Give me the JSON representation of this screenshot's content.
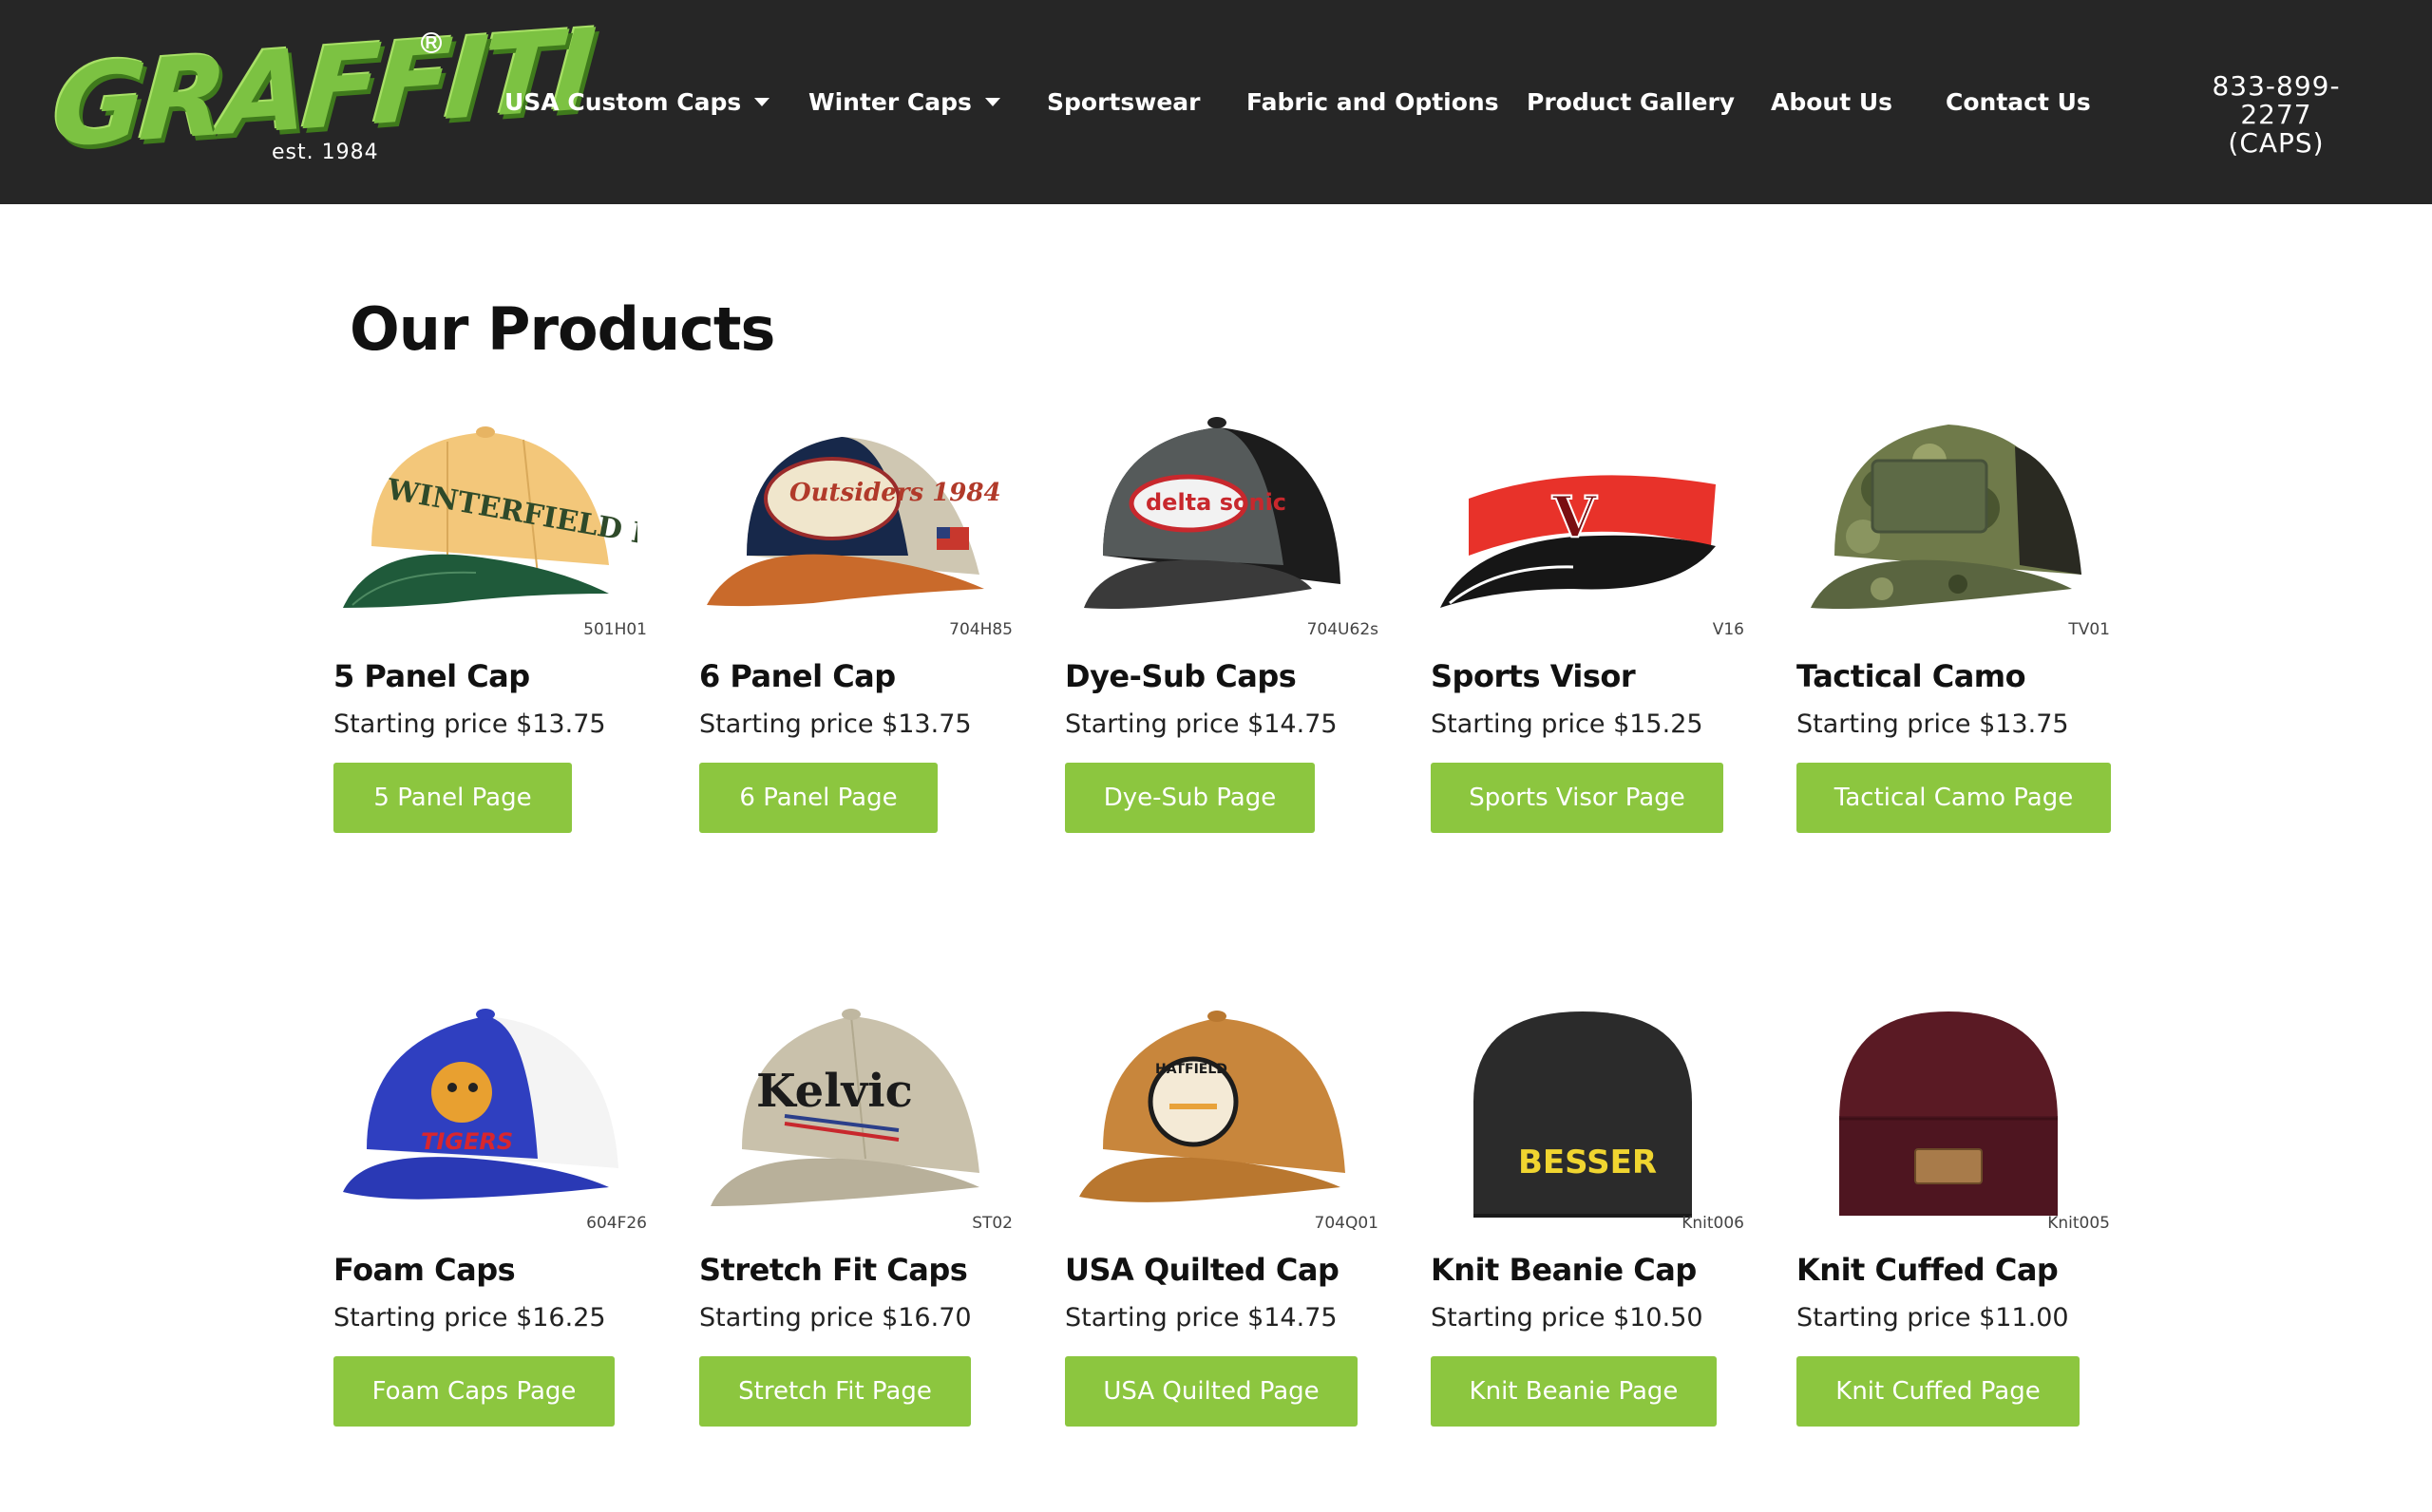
{
  "brand": {
    "logo_text": "GRAFFITI",
    "logo_established": "est. 1984",
    "logo_registered": "R",
    "colors": {
      "header_bg": "#262626",
      "logo_green": "#7cc242",
      "button_green": "#8cc63f"
    }
  },
  "nav": {
    "items": [
      {
        "label": "USA Custom Caps",
        "has_dropdown": true
      },
      {
        "label": "Winter Caps",
        "has_dropdown": true
      },
      {
        "label": "Sportswear",
        "has_dropdown": false
      },
      {
        "label": "Fabric and Options",
        "has_dropdown": false
      },
      {
        "label": "Product Gallery",
        "has_dropdown": false
      },
      {
        "label": "About Us",
        "has_dropdown": false
      },
      {
        "label": "Contact Us",
        "has_dropdown": false
      }
    ],
    "phone_line1": "833-899-2277",
    "phone_line2": "(CAPS)"
  },
  "main": {
    "title": "Our Products",
    "products": [
      {
        "name": "5 Panel Cap",
        "price": "Starting price $13.75",
        "button": "5 Panel Page",
        "sku": "501H01",
        "icon": "trucker-cap-yellow-green-icon",
        "cap_text": "WINTERFIELD FLORAL SHOP"
      },
      {
        "name": "6 Panel Cap",
        "price": "Starting price $13.75",
        "button": "6 Panel Page",
        "sku": "704H85",
        "icon": "trucker-cap-navy-orange-icon",
        "cap_text": "Outsiders 1984"
      },
      {
        "name": "Dye-Sub Caps",
        "price": "Starting price $14.75",
        "button": "Dye-Sub Page",
        "sku": "704U62s",
        "icon": "dye-sub-cap-black-icon",
        "cap_text": "delta sonic"
      },
      {
        "name": "Sports Visor",
        "price": "Starting price $15.25",
        "button": "Sports Visor Page",
        "sku": "V16",
        "icon": "visor-red-black-icon",
        "cap_text": "V"
      },
      {
        "name": "Tactical Camo",
        "price": "Starting price $13.75",
        "button": "Tactical Camo Page",
        "sku": "TV01",
        "icon": "camo-cap-icon",
        "cap_text": ""
      },
      {
        "name": "Foam Caps",
        "price": "Starting price $16.25",
        "button": "Foam Caps Page",
        "sku": "604F26",
        "icon": "foam-cap-blue-white-icon",
        "cap_text": "TIGERS"
      },
      {
        "name": "Stretch Fit Caps",
        "price": "Starting price $16.70",
        "button": "Stretch Fit Page",
        "sku": "ST02",
        "icon": "stretch-fit-cap-tan-icon",
        "cap_text": "Kelvic"
      },
      {
        "name": "USA Quilted Cap",
        "price": "Starting price $14.75",
        "button": "USA Quilted Page",
        "sku": "704Q01",
        "icon": "quilted-cap-brown-icon",
        "cap_text": "HATFIELD"
      },
      {
        "name": "Knit Beanie Cap",
        "price": "Starting price $10.50",
        "button": "Knit Beanie Page",
        "sku": "Knit006",
        "icon": "beanie-black-icon",
        "cap_text": "BESSER"
      },
      {
        "name": "Knit Cuffed Cap",
        "price": "Starting price $11.00",
        "button": "Knit Cuffed Page",
        "sku": "Knit005",
        "icon": "cuffed-beanie-maroon-icon",
        "cap_text": ""
      }
    ]
  }
}
